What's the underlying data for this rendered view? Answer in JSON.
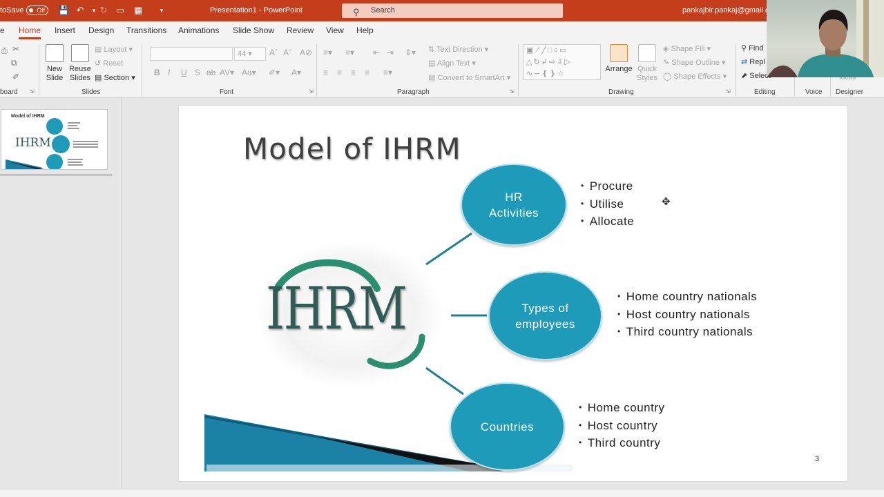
{
  "titlebar": {
    "autosave_label": "toSave",
    "autosave_state": "Off",
    "doc_title": "Presentation1 - PowerPoint",
    "search_placeholder": "Search",
    "account": "pankajbir.pankaj@gmail.co"
  },
  "tabs": [
    "Home",
    "Insert",
    "Design",
    "Transitions",
    "Animations",
    "Slide Show",
    "Review",
    "View",
    "Help"
  ],
  "active_tab": "Home",
  "ribbon": {
    "clipboard_label": "board",
    "slides": {
      "new_slide": "New Slide",
      "reuse_slides": "Reuse Slides",
      "layout": "Layout",
      "reset": "Reset",
      "section": "Section",
      "label": "Slides"
    },
    "font": {
      "size": "44",
      "bold": "B",
      "italic": "I",
      "underline": "U",
      "strike": "S",
      "label": "Font"
    },
    "paragraph": {
      "text_direction": "Text Direction",
      "align_text": "Align Text",
      "smartart": "Convert to SmartArt",
      "label": "Paragraph"
    },
    "drawing": {
      "arrange": "Arrange",
      "quick_styles": "Quick Styles",
      "shape_fill": "Shape Fill",
      "shape_outline": "Shape Outline",
      "shape_effects": "Shape Effects",
      "label": "Drawing"
    },
    "editing": {
      "find": "Find",
      "replace": "Repl",
      "select": "Select",
      "label": "Editing"
    },
    "voice_label": "Voice",
    "designer_label": "Designer",
    "ideas_label": "Ideas"
  },
  "thumbnail": {
    "title": "Model of IHRM",
    "logo_text": "IHRM"
  },
  "slide": {
    "title": "Model of IHRM",
    "logo_text": "IHRM",
    "circles": [
      {
        "label_line1": "HR",
        "label_line2": "Activities",
        "items": [
          "Procure",
          "Utilise",
          "Allocate"
        ]
      },
      {
        "label_line1": "Types of",
        "label_line2": "employees",
        "items": [
          "Home country nationals",
          "Host country nationals",
          "Third country nationals"
        ]
      },
      {
        "label_line1": "Countries",
        "label_line2": "",
        "items": [
          "Home country",
          "Host country",
          "Third country"
        ]
      }
    ],
    "page_number": "3"
  },
  "colors": {
    "accent": "#c43e1c",
    "circle": "#1e9bb8",
    "logo_green": "#2a8f6f"
  }
}
